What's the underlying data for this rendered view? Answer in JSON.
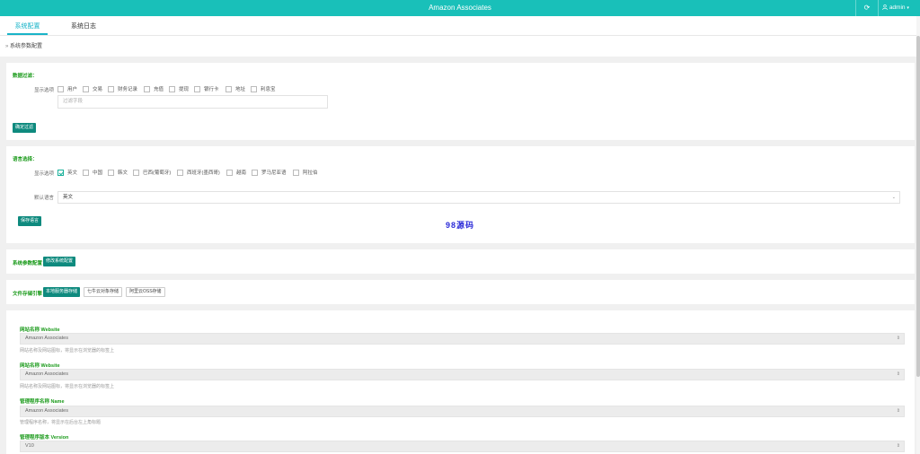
{
  "header": {
    "title": "Amazon Associates",
    "refresh_icon": "⟳",
    "user_label": "admin",
    "user_icon": "user-icon",
    "dropdown_icon": "▾",
    "brand_color": "#19c0b9"
  },
  "tabs": [
    {
      "label": "系统配置",
      "active": true
    },
    {
      "label": "系统日志",
      "active": false
    }
  ],
  "breadcrumb": "系统参数配置",
  "data_filter": {
    "section_title": "数据过滤：",
    "options_label": "显示选项",
    "options": [
      "用户",
      "交易",
      "财务记录",
      "充值",
      "提现",
      "银行卡",
      "地址",
      "利息宝"
    ],
    "input_placeholder": "过滤字段",
    "confirm_button": "确定过滤"
  },
  "language": {
    "section_title": "语言选择：",
    "options_label": "显示选项",
    "options": [
      {
        "label": "英文",
        "checked": true
      },
      {
        "label": "中国",
        "checked": false
      },
      {
        "label": "韩文",
        "checked": false
      },
      {
        "label": "巴西(葡萄牙)",
        "checked": false
      },
      {
        "label": "西班牙(墨西哥)",
        "checked": false
      },
      {
        "label": "越南",
        "checked": false
      },
      {
        "label": "罗马尼亚语",
        "checked": false
      },
      {
        "label": "阿拉伯",
        "checked": false
      }
    ],
    "default_label": "默认语言",
    "default_value": "英文",
    "save_button": "保存语言",
    "watermark": "98源码"
  },
  "sys_params": {
    "label": "系统参数配置：",
    "button": "修改系统配置"
  },
  "storage": {
    "label": "文件存储引擎：",
    "buttons": [
      {
        "label": "本地服务器存储",
        "active": true
      },
      {
        "label": "七牛云对象存储",
        "active": false
      },
      {
        "label": "阿里云OSS存储",
        "active": false
      }
    ]
  },
  "fields": [
    {
      "title": "网站名称 Website",
      "value": "Amazon Associates",
      "hint": "网站名称及网站图标，将显示在浏览器的标签上"
    },
    {
      "title": "网站名称 Website",
      "value": "Amazon Associates",
      "hint": "网站名称及网站图标，将显示在浏览器的标签上"
    },
    {
      "title": "管理程序名称 Name",
      "value": "Amazon Associates",
      "hint": "管理程序名称，将显示在后台左上角标题"
    },
    {
      "title": "管理程序版本 Version",
      "value": "V10",
      "hint": ""
    }
  ]
}
